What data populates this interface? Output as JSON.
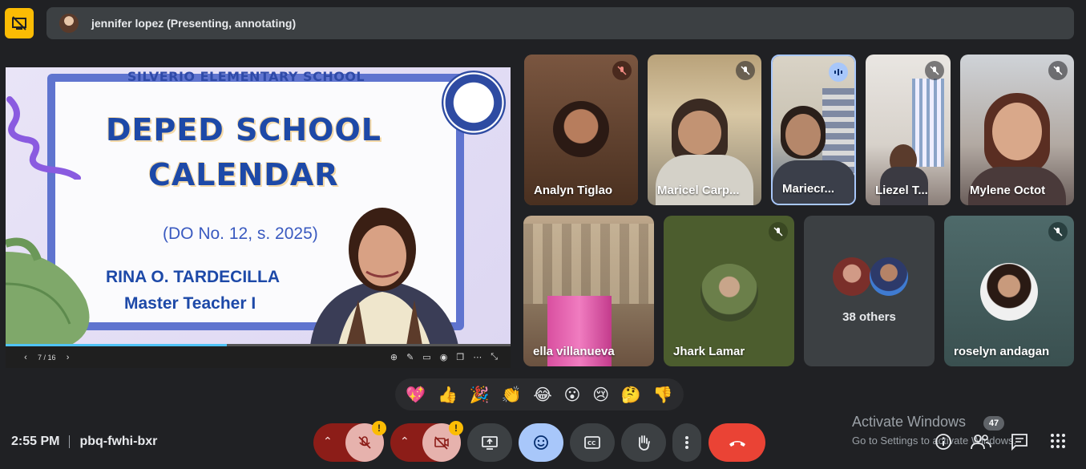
{
  "presenter_bar": {
    "text": "jennifer lopez (Presenting, annotating)"
  },
  "slide": {
    "school": "SILVERIO ELEMENTARY SCHOOL",
    "title_line1": "DEPED SCHOOL",
    "title_line2": "CALENDAR",
    "order": "(DO No. 12, s. 2025)",
    "presenter_name": "RINA O. TARDECILLA",
    "presenter_role": "Master Teacher I",
    "page": "7 / 16",
    "progress": 0.4375
  },
  "participants": [
    {
      "name": "Analyn Tiglao"
    },
    {
      "name": "Maricel Carp..."
    },
    {
      "name": "Mariecr..."
    },
    {
      "name": "Liezel T..."
    },
    {
      "name": "Mylene Octot"
    },
    {
      "name": "ella villanueva"
    },
    {
      "name": "Jhark Lamar"
    },
    {
      "name": "38 others"
    },
    {
      "name": "roselyn andagan"
    }
  ],
  "reactions": [
    "💖",
    "👍",
    "🎉",
    "👏",
    "😂",
    "😮",
    "😢",
    "🤔",
    "👎"
  ],
  "footer": {
    "time": "2:55 PM",
    "meeting_code": "pbq-fwhi-bxr",
    "warn_mark": "!",
    "people_count": "47"
  },
  "watermark": {
    "line1": "Activate Windows",
    "line2": "Go to Settings to activate Windows."
  },
  "colors": {
    "background": "#202124",
    "bar": "#3c4043",
    "accent_yellow": "#fbbc04",
    "end_call_red": "#ea4335",
    "muted_red": "#8c1d18",
    "reaction_active": "#a8c7fa"
  },
  "icons": [
    "hide-presentation-icon",
    "mic-off-icon",
    "camera-off-icon",
    "present-screen-icon",
    "emoji-icon",
    "captions-icon",
    "raise-hand-icon",
    "more-options-icon",
    "end-call-icon",
    "info-icon",
    "people-icon",
    "chat-icon",
    "activities-icon"
  ]
}
